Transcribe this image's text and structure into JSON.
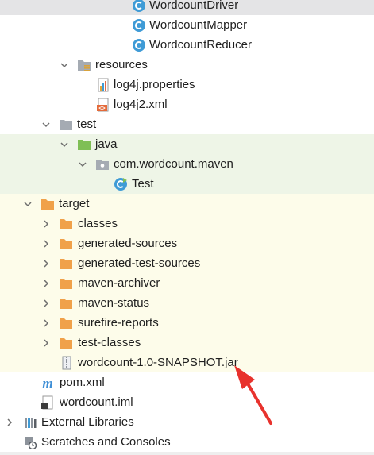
{
  "tree": {
    "wordcount_driver": "WordcountDriver",
    "wordcount_mapper": "WordcountMapper",
    "wordcount_reducer": "WordcountReducer",
    "resources": "resources",
    "log4j_properties": "log4j.properties",
    "log4j2_xml": "log4j2.xml",
    "test": "test",
    "java": "java",
    "package": "com.wordcount.maven",
    "test_class": "Test",
    "target": "target",
    "classes": "classes",
    "generated_sources": "generated-sources",
    "generated_test_sources": "generated-test-sources",
    "maven_archiver": "maven-archiver",
    "maven_status": "maven-status",
    "surefire_reports": "surefire-reports",
    "test_classes": "test-classes",
    "jar_file": "wordcount-1.0-SNAPSHOT.jar",
    "pom_xml": "pom.xml",
    "wordcount_iml": "wordcount.iml",
    "external_libraries": "External Libraries",
    "scratches_consoles": "Scratches and Consoles"
  },
  "colors": {
    "selected_row": "#e4e4e6",
    "test_source_bg": "#eef5e7",
    "excluded_bg": "#fdfcea",
    "class_icon": "#3f9bd6",
    "folder_gray": "#a5abb3",
    "folder_orange": "#f0a14a",
    "folder_green": "#7fbf55",
    "annotation_arrow": "#e8322d"
  }
}
